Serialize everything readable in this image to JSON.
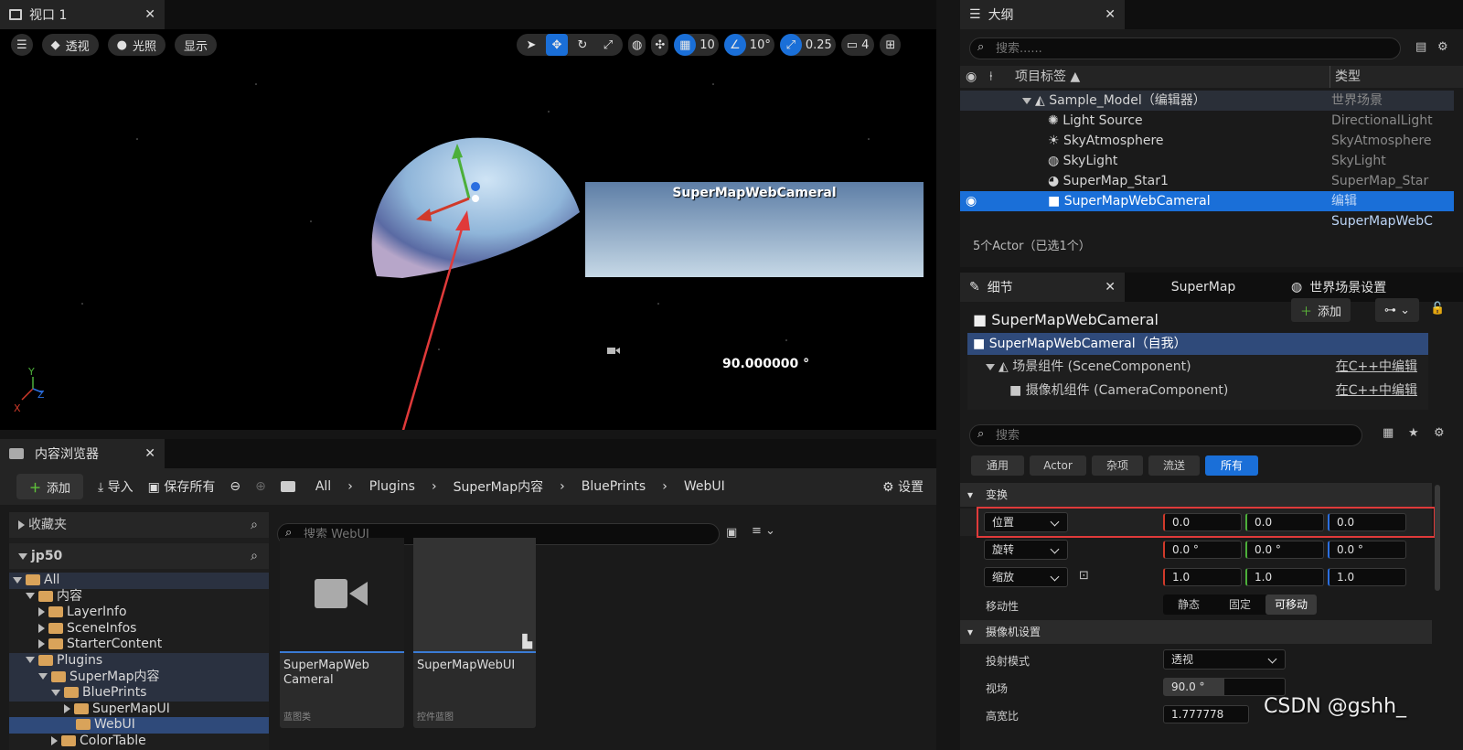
{
  "viewport": {
    "tab_title": "视口 1",
    "toolbar": {
      "perspective": "透视",
      "lighting": "光照",
      "show": "显示",
      "grid_snap": "10",
      "rot_snap": "10°",
      "scale_snap": "0.25",
      "cam_speed": "4"
    },
    "camera_label": "SuperMapWebCameral",
    "angle_readout": "90.000000 °",
    "axis_y": "Y",
    "axis_x": "X",
    "axis_z": "Z"
  },
  "content_browser": {
    "tab_title": "内容浏览器",
    "add_label": "添加",
    "import_label": "导入",
    "save_all_label": "保存所有",
    "settings_label": "设置",
    "breadcrumb": [
      "All",
      "Plugins",
      "SuperMap内容",
      "BluePrints",
      "WebUI"
    ],
    "favorites_label": "收藏夹",
    "project_label": "jp50",
    "search_placeholder": "搜索 WebUI",
    "tree": [
      "All",
      "内容",
      "LayerInfo",
      "SceneInfos",
      "StarterContent",
      "Plugins",
      "SuperMap内容",
      "BluePrints",
      "SuperMapUI",
      "WebUI",
      "ColorTable"
    ],
    "assets": [
      {
        "name_line1": "SuperMapWeb",
        "name_line2": "Cameral",
        "type": "蓝图类"
      },
      {
        "name_line1": "SuperMapWebUI",
        "name_line2": "",
        "type": "控件蓝图"
      }
    ]
  },
  "outliner": {
    "tab_title": "大纲",
    "search_placeholder": "搜索......",
    "col_label": "项目标签 ▲",
    "col_type": "类型",
    "rows": [
      {
        "label": "Sample_Model（编辑器）",
        "type": "世界场景"
      },
      {
        "label": "Light Source",
        "type": "DirectionalLight"
      },
      {
        "label": "SkyAtmosphere",
        "type": "SkyAtmosphere"
      },
      {
        "label": "SkyLight",
        "type": "SkyLight"
      },
      {
        "label": "SuperMap_Star1",
        "type": "SuperMap_Star"
      },
      {
        "label": "SuperMapWebCameral",
        "type": "编辑SuperMapWebC"
      }
    ],
    "status": "5个Actor（已选1个）"
  },
  "details": {
    "tab_title": "细节",
    "tab_supermap": "SuperMap",
    "tab_world": "世界场景设置",
    "actor_name": "SuperMapWebCameral",
    "add_label": "添加",
    "components": [
      {
        "label": "SuperMapWebCameral（自我）",
        "link": ""
      },
      {
        "label": "场景组件 (SceneComponent)",
        "link": "在C++中编辑"
      },
      {
        "label": "摄像机组件 (CameraComponent)",
        "link": "在C++中编辑"
      }
    ],
    "search_placeholder": "搜索",
    "filters": [
      "通用",
      "Actor",
      "杂项",
      "流送",
      "所有"
    ],
    "transform_section": "变换",
    "location": {
      "label": "位置",
      "x": "0.0",
      "y": "0.0",
      "z": "0.0"
    },
    "rotation": {
      "label": "旋转",
      "x": "0.0 °",
      "y": "0.0 °",
      "z": "0.0 °"
    },
    "scale": {
      "label": "缩放",
      "x": "1.0",
      "y": "1.0",
      "z": "1.0"
    },
    "mobility": {
      "label": "移动性",
      "options": [
        "静态",
        "固定",
        "可移动"
      ]
    },
    "camera_section": "摄像机设置",
    "projection": {
      "label": "投射模式",
      "value": "透视"
    },
    "fov": {
      "label": "视场",
      "value": "90.0 °"
    },
    "aspect": {
      "label": "高宽比",
      "value": "1.777778"
    }
  },
  "watermark": "CSDN @gshh_"
}
